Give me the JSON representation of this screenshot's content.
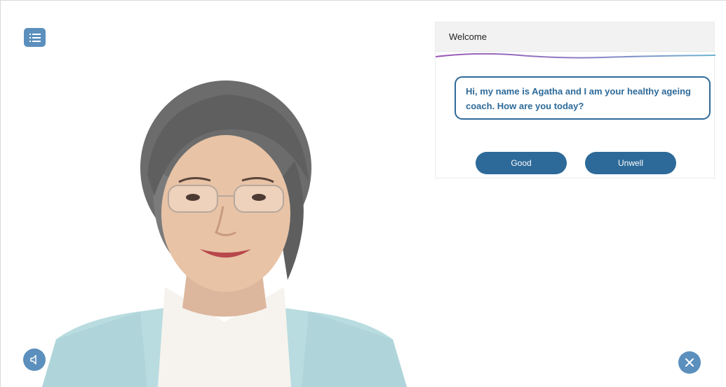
{
  "toolbar": {
    "menu_icon": "list-menu-icon"
  },
  "chat": {
    "title": "Welcome",
    "message": "Hi, my name is Agatha and I am your healthy ageing coach. How are you today?",
    "responses": [
      "Good",
      "Unwell"
    ]
  },
  "controls": {
    "sound_icon": "speaker-icon",
    "close_icon": "close-icon"
  },
  "colors": {
    "accent": "#2d6a99",
    "icon_button": "#5b8fbd",
    "header_bg": "#f2f2f2"
  }
}
